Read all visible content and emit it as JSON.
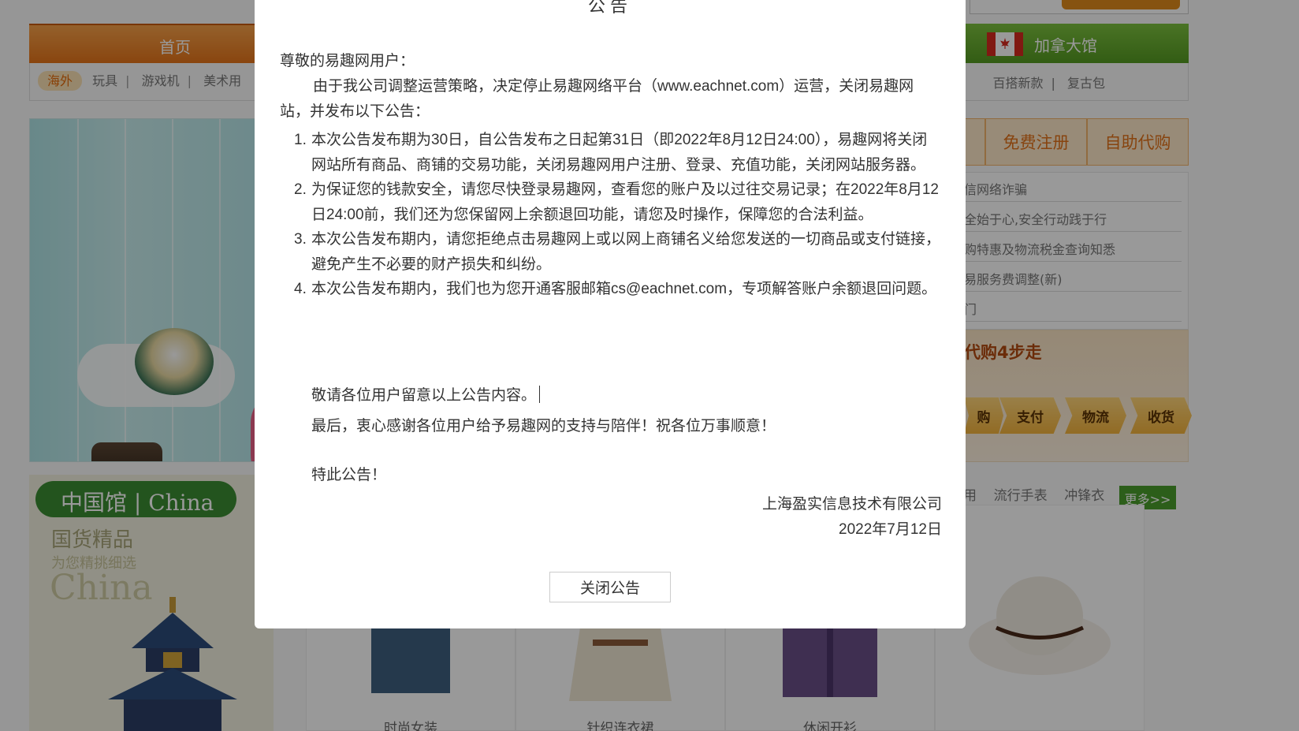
{
  "background": {
    "nav": {
      "home_label": "首页",
      "canada_label": "加拿大馆"
    },
    "subnav_left": {
      "active": "海外",
      "items": [
        "玩具",
        "游戏机",
        "美术用"
      ]
    },
    "subnav_right": {
      "items": [
        "百搭新款",
        "复古包"
      ]
    },
    "sidebar_buttons": {
      "register": "免费注册",
      "self_purchase": "自助代购"
    },
    "news": [
      "信网络诈骗",
      "全始于心,安全行动践于行",
      "购特惠及物流税金查询知悉",
      "易服务费调整(新)",
      "门"
    ],
    "steps": {
      "title": "代购4步走",
      "items": [
        "购",
        "支付",
        "物流",
        "收货"
      ]
    },
    "china": {
      "pill": "中国馆 | China",
      "line1": "国货精品",
      "line2": "为您精挑细选",
      "line3": "China"
    },
    "tags": [
      "用",
      "流行手表",
      "冲锋衣"
    ],
    "more_label": "更多>>",
    "products": [
      {
        "caption": "时尚女装"
      },
      {
        "caption": "针织连衣裙"
      },
      {
        "caption": "休闲开衫"
      },
      {
        "caption": ""
      }
    ]
  },
  "dialog": {
    "title": "公告",
    "greeting": "尊敬的易趣网用户：",
    "intro": "由于我公司调整运营策略，决定停止易趣网络平台（www.eachnet.com）运营，关闭易趣网站，并发布以下公告：",
    "items": [
      {
        "num": "1.",
        "text": "本次公告发布期为30日，自公告发布之日起第31日（即2022年8月12日24:00），易趣网将关闭网站所有商品、商铺的交易功能，关闭易趣网用户注册、登录、充值功能，关闭网站服务器。"
      },
      {
        "num": "2.",
        "text": "为保证您的钱款安全，请您尽快登录易趣网，查看您的账户及以过往交易记录；在2022年8月12日24:00前，我们还为您保留网上余额退回功能，请您及时操作，保障您的合法利益。"
      },
      {
        "num": "3.",
        "text": "本次公告发布期内，请您拒绝点击易趣网上或以网上商铺名义给您发送的一切商品或支付链接，避免产生不必要的财产损失和纠纷。"
      },
      {
        "num": "4.",
        "text": "本次公告发布期内，我们也为您开通客服邮箱cs@eachnet.com，专项解答账户余额退回问题。"
      }
    ],
    "notice": "敬请各位用户留意以上公告内容。",
    "thanks": "最后，衷心感谢各位用户给予易趣网的支持与陪伴！祝各位万事顺意！",
    "special": "特此公告！",
    "company": "上海盈实信息技术有限公司",
    "date": "2022年7月12日",
    "close_label": "关闭公告"
  }
}
